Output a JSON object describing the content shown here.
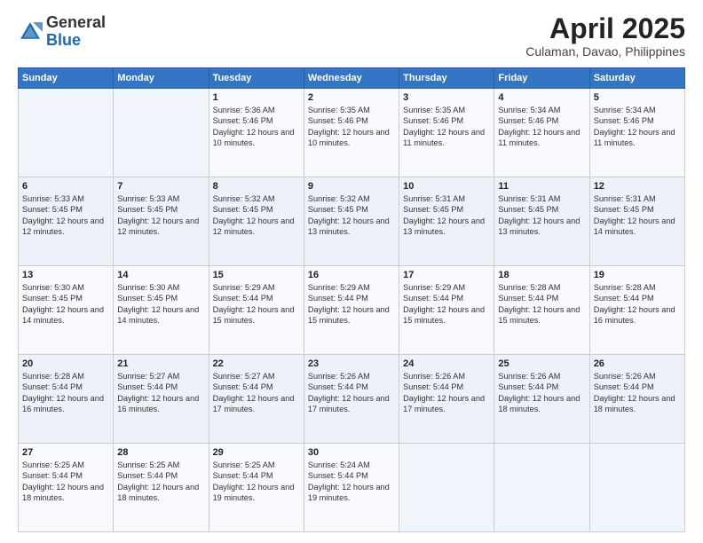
{
  "header": {
    "logo_general": "General",
    "logo_blue": "Blue",
    "month_title": "April 2025",
    "location": "Culaman, Davao, Philippines"
  },
  "weekdays": [
    "Sunday",
    "Monday",
    "Tuesday",
    "Wednesday",
    "Thursday",
    "Friday",
    "Saturday"
  ],
  "weeks": [
    [
      {
        "day": "",
        "sunrise": "",
        "sunset": "",
        "daylight": ""
      },
      {
        "day": "",
        "sunrise": "",
        "sunset": "",
        "daylight": ""
      },
      {
        "day": "1",
        "sunrise": "Sunrise: 5:36 AM",
        "sunset": "Sunset: 5:46 PM",
        "daylight": "Daylight: 12 hours and 10 minutes."
      },
      {
        "day": "2",
        "sunrise": "Sunrise: 5:35 AM",
        "sunset": "Sunset: 5:46 PM",
        "daylight": "Daylight: 12 hours and 10 minutes."
      },
      {
        "day": "3",
        "sunrise": "Sunrise: 5:35 AM",
        "sunset": "Sunset: 5:46 PM",
        "daylight": "Daylight: 12 hours and 11 minutes."
      },
      {
        "day": "4",
        "sunrise": "Sunrise: 5:34 AM",
        "sunset": "Sunset: 5:46 PM",
        "daylight": "Daylight: 12 hours and 11 minutes."
      },
      {
        "day": "5",
        "sunrise": "Sunrise: 5:34 AM",
        "sunset": "Sunset: 5:46 PM",
        "daylight": "Daylight: 12 hours and 11 minutes."
      }
    ],
    [
      {
        "day": "6",
        "sunrise": "Sunrise: 5:33 AM",
        "sunset": "Sunset: 5:45 PM",
        "daylight": "Daylight: 12 hours and 12 minutes."
      },
      {
        "day": "7",
        "sunrise": "Sunrise: 5:33 AM",
        "sunset": "Sunset: 5:45 PM",
        "daylight": "Daylight: 12 hours and 12 minutes."
      },
      {
        "day": "8",
        "sunrise": "Sunrise: 5:32 AM",
        "sunset": "Sunset: 5:45 PM",
        "daylight": "Daylight: 12 hours and 12 minutes."
      },
      {
        "day": "9",
        "sunrise": "Sunrise: 5:32 AM",
        "sunset": "Sunset: 5:45 PM",
        "daylight": "Daylight: 12 hours and 13 minutes."
      },
      {
        "day": "10",
        "sunrise": "Sunrise: 5:31 AM",
        "sunset": "Sunset: 5:45 PM",
        "daylight": "Daylight: 12 hours and 13 minutes."
      },
      {
        "day": "11",
        "sunrise": "Sunrise: 5:31 AM",
        "sunset": "Sunset: 5:45 PM",
        "daylight": "Daylight: 12 hours and 13 minutes."
      },
      {
        "day": "12",
        "sunrise": "Sunrise: 5:31 AM",
        "sunset": "Sunset: 5:45 PM",
        "daylight": "Daylight: 12 hours and 14 minutes."
      }
    ],
    [
      {
        "day": "13",
        "sunrise": "Sunrise: 5:30 AM",
        "sunset": "Sunset: 5:45 PM",
        "daylight": "Daylight: 12 hours and 14 minutes."
      },
      {
        "day": "14",
        "sunrise": "Sunrise: 5:30 AM",
        "sunset": "Sunset: 5:45 PM",
        "daylight": "Daylight: 12 hours and 14 minutes."
      },
      {
        "day": "15",
        "sunrise": "Sunrise: 5:29 AM",
        "sunset": "Sunset: 5:44 PM",
        "daylight": "Daylight: 12 hours and 15 minutes."
      },
      {
        "day": "16",
        "sunrise": "Sunrise: 5:29 AM",
        "sunset": "Sunset: 5:44 PM",
        "daylight": "Daylight: 12 hours and 15 minutes."
      },
      {
        "day": "17",
        "sunrise": "Sunrise: 5:29 AM",
        "sunset": "Sunset: 5:44 PM",
        "daylight": "Daylight: 12 hours and 15 minutes."
      },
      {
        "day": "18",
        "sunrise": "Sunrise: 5:28 AM",
        "sunset": "Sunset: 5:44 PM",
        "daylight": "Daylight: 12 hours and 15 minutes."
      },
      {
        "day": "19",
        "sunrise": "Sunrise: 5:28 AM",
        "sunset": "Sunset: 5:44 PM",
        "daylight": "Daylight: 12 hours and 16 minutes."
      }
    ],
    [
      {
        "day": "20",
        "sunrise": "Sunrise: 5:28 AM",
        "sunset": "Sunset: 5:44 PM",
        "daylight": "Daylight: 12 hours and 16 minutes."
      },
      {
        "day": "21",
        "sunrise": "Sunrise: 5:27 AM",
        "sunset": "Sunset: 5:44 PM",
        "daylight": "Daylight: 12 hours and 16 minutes."
      },
      {
        "day": "22",
        "sunrise": "Sunrise: 5:27 AM",
        "sunset": "Sunset: 5:44 PM",
        "daylight": "Daylight: 12 hours and 17 minutes."
      },
      {
        "day": "23",
        "sunrise": "Sunrise: 5:26 AM",
        "sunset": "Sunset: 5:44 PM",
        "daylight": "Daylight: 12 hours and 17 minutes."
      },
      {
        "day": "24",
        "sunrise": "Sunrise: 5:26 AM",
        "sunset": "Sunset: 5:44 PM",
        "daylight": "Daylight: 12 hours and 17 minutes."
      },
      {
        "day": "25",
        "sunrise": "Sunrise: 5:26 AM",
        "sunset": "Sunset: 5:44 PM",
        "daylight": "Daylight: 12 hours and 18 minutes."
      },
      {
        "day": "26",
        "sunrise": "Sunrise: 5:26 AM",
        "sunset": "Sunset: 5:44 PM",
        "daylight": "Daylight: 12 hours and 18 minutes."
      }
    ],
    [
      {
        "day": "27",
        "sunrise": "Sunrise: 5:25 AM",
        "sunset": "Sunset: 5:44 PM",
        "daylight": "Daylight: 12 hours and 18 minutes."
      },
      {
        "day": "28",
        "sunrise": "Sunrise: 5:25 AM",
        "sunset": "Sunset: 5:44 PM",
        "daylight": "Daylight: 12 hours and 18 minutes."
      },
      {
        "day": "29",
        "sunrise": "Sunrise: 5:25 AM",
        "sunset": "Sunset: 5:44 PM",
        "daylight": "Daylight: 12 hours and 19 minutes."
      },
      {
        "day": "30",
        "sunrise": "Sunrise: 5:24 AM",
        "sunset": "Sunset: 5:44 PM",
        "daylight": "Daylight: 12 hours and 19 minutes."
      },
      {
        "day": "",
        "sunrise": "",
        "sunset": "",
        "daylight": ""
      },
      {
        "day": "",
        "sunrise": "",
        "sunset": "",
        "daylight": ""
      },
      {
        "day": "",
        "sunrise": "",
        "sunset": "",
        "daylight": ""
      }
    ]
  ]
}
